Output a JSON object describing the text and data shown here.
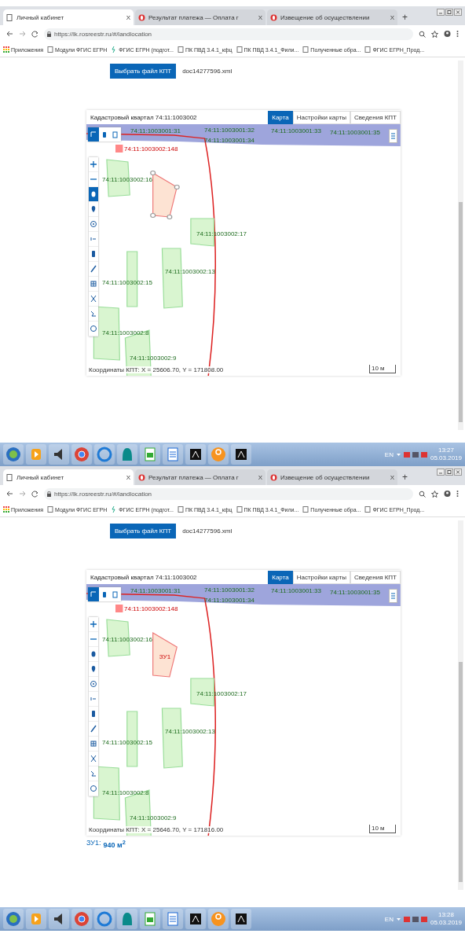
{
  "screens": [
    {
      "tabs": [
        {
          "title": "Личный кабинет",
          "kind": "document",
          "close": "X",
          "selected": true
        },
        {
          "title": "Результат платежа — Оплата г",
          "kind": "alert",
          "close": "X",
          "selected": false
        },
        {
          "title": "Извещение об осуществлении",
          "kind": "alert",
          "close": "X",
          "selected": false
        }
      ],
      "new_tab": "+",
      "address": "https://lk.rosreestr.ru/#/landlocation",
      "bookmarks": [
        {
          "label": "Приложения",
          "kind": "apps"
        },
        {
          "label": "Модули ФГИС ЕГРН",
          "kind": "page"
        },
        {
          "label": "ФГИС ЕГРН (подгот...",
          "kind": "link"
        },
        {
          "label": "ПК ПВД 3.4.1_кфц",
          "kind": "page"
        },
        {
          "label": "ПК ПВД 3.4.1_Фили...",
          "kind": "page"
        },
        {
          "label": "Полученные обра...",
          "kind": "page"
        },
        {
          "label": "ФГИС ЕГРН_Прод...",
          "kind": "page"
        }
      ],
      "file_button": "Выбрать файл КПТ",
      "file_name": "doc14277596.xml",
      "map": {
        "title": "Кадастровый квартал 74:11:1003002",
        "tabs": [
          {
            "label": "Карта",
            "selected": true
          },
          {
            "label": "Настройки карты",
            "selected": false
          },
          {
            "label": "Сведения КПТ",
            "selected": false
          }
        ],
        "corner_tools": [
          {
            "kind": "select",
            "selected": true
          },
          {
            "kind": "marker",
            "selected": false
          },
          {
            "kind": "copy",
            "selected": false
          }
        ],
        "side_tools": [
          {
            "kind": "plus",
            "selected": false
          },
          {
            "kind": "minus",
            "selected": false
          },
          {
            "kind": "point",
            "selected": true
          },
          {
            "kind": "pin",
            "selected": false
          },
          {
            "kind": "locate",
            "selected": false
          },
          {
            "kind": "measure",
            "selected": false
          },
          {
            "kind": "layer",
            "selected": false
          },
          {
            "kind": "pen",
            "selected": false
          },
          {
            "kind": "table",
            "selected": false
          },
          {
            "kind": "scissors",
            "selected": false
          },
          {
            "kind": "route",
            "selected": false
          },
          {
            "kind": "circle",
            "selected": false
          }
        ],
        "features": [
          {
            "kind": "band-label",
            "label": "74:11:1003001:31"
          },
          {
            "kind": "band-label",
            "label": "74:11:1003001:32"
          },
          {
            "kind": "band-label",
            "label": "74:11:1003001:33"
          },
          {
            "kind": "band-label",
            "label": "74:11:1003001:34"
          },
          {
            "kind": "band-label",
            "label": "74:11:1003001:35"
          },
          {
            "kind": "boundary-label",
            "label": "74:11:1003002:148"
          },
          {
            "kind": "parcel",
            "label": "74:11:1003002:16"
          },
          {
            "kind": "draft",
            "editing": true
          },
          {
            "kind": "parcel",
            "label": "74:11:1003002:17"
          },
          {
            "kind": "parcel",
            "label": "74:11:1003002:13"
          },
          {
            "kind": "parcel",
            "label": "74:11:1003002:15"
          },
          {
            "kind": "parcel",
            "label": "74:11:1003002:8"
          },
          {
            "kind": "parcel",
            "label": "74:11:1003002:9"
          }
        ],
        "coordinates": "Координаты КПТ: X = 25606.70, Y = 171808.00",
        "scale": "10 м"
      },
      "taskbar": {
        "language": "EN",
        "time": "13:27",
        "date": "05.03.2019"
      }
    },
    {
      "tabs": [
        {
          "title": "Личный кабинет",
          "kind": "document",
          "close": "X",
          "selected": true
        },
        {
          "title": "Результат платежа — Оплата г",
          "kind": "alert",
          "close": "X",
          "selected": false
        },
        {
          "title": "Извещение об осуществлении",
          "kind": "alert",
          "close": "X",
          "selected": false
        }
      ],
      "new_tab": "+",
      "address": "https://lk.rosreestr.ru/#/landlocation",
      "bookmarks": [
        {
          "label": "Приложения",
          "kind": "apps"
        },
        {
          "label": "Модули ФГИС ЕГРН",
          "kind": "page"
        },
        {
          "label": "ФГИС ЕГРН (подгот...",
          "kind": "link"
        },
        {
          "label": "ПК ПВД 3.4.1_кфц",
          "kind": "page"
        },
        {
          "label": "ПК ПВД 3.4.1_Фили...",
          "kind": "page"
        },
        {
          "label": "Полученные обра...",
          "kind": "page"
        },
        {
          "label": "ФГИС ЕГРН_Прод...",
          "kind": "page"
        }
      ],
      "file_button": "Выбрать файл КПТ",
      "file_name": "doc14277596.xml",
      "map": {
        "title": "Кадастровый квартал 74:11:1003002",
        "tabs": [
          {
            "label": "Карта",
            "selected": true
          },
          {
            "label": "Настройки карты",
            "selected": false
          },
          {
            "label": "Сведения КПТ",
            "selected": false
          }
        ],
        "corner_tools": [
          {
            "kind": "select",
            "selected": true
          },
          {
            "kind": "marker",
            "selected": false
          },
          {
            "kind": "copy",
            "selected": false
          }
        ],
        "side_tools": [
          {
            "kind": "plus",
            "selected": false
          },
          {
            "kind": "minus",
            "selected": false
          },
          {
            "kind": "point",
            "selected": false
          },
          {
            "kind": "pin",
            "selected": false
          },
          {
            "kind": "locate",
            "selected": false
          },
          {
            "kind": "measure",
            "selected": false
          },
          {
            "kind": "layer",
            "selected": false
          },
          {
            "kind": "pen",
            "selected": false
          },
          {
            "kind": "table",
            "selected": false
          },
          {
            "kind": "scissors",
            "selected": false
          },
          {
            "kind": "route",
            "selected": false
          },
          {
            "kind": "circle",
            "selected": false
          }
        ],
        "features": [
          {
            "kind": "band-label",
            "label": "74:11:1003001:31"
          },
          {
            "kind": "band-label",
            "label": "74:11:1003001:32"
          },
          {
            "kind": "band-label",
            "label": "74:11:1003001:33"
          },
          {
            "kind": "band-label",
            "label": "74:11:1003001:34"
          },
          {
            "kind": "band-label",
            "label": "74:11:1003001:35"
          },
          {
            "kind": "boundary-label",
            "label": "74:11:1003002:148"
          },
          {
            "kind": "parcel",
            "label": "74:11:1003002:16"
          },
          {
            "kind": "draft",
            "editing": false,
            "label": "ЗУ1"
          },
          {
            "kind": "parcel",
            "label": "74:11:1003002:17"
          },
          {
            "kind": "parcel",
            "label": "74:11:1003002:13"
          },
          {
            "kind": "parcel",
            "label": "74:11:1003002:15"
          },
          {
            "kind": "parcel",
            "label": "74:11:1003002:8"
          },
          {
            "kind": "parcel",
            "label": "74:11:1003002:9"
          }
        ],
        "coordinates": "Координаты КПТ: X = 25646.70, Y = 171816.00",
        "scale": "10 м"
      },
      "area": {
        "label": "ЗУ1:",
        "value": "940 м$^{2}$"
      },
      "taskbar": {
        "language": "EN",
        "time": "13:28",
        "date": "05.03.2019"
      }
    }
  ]
}
